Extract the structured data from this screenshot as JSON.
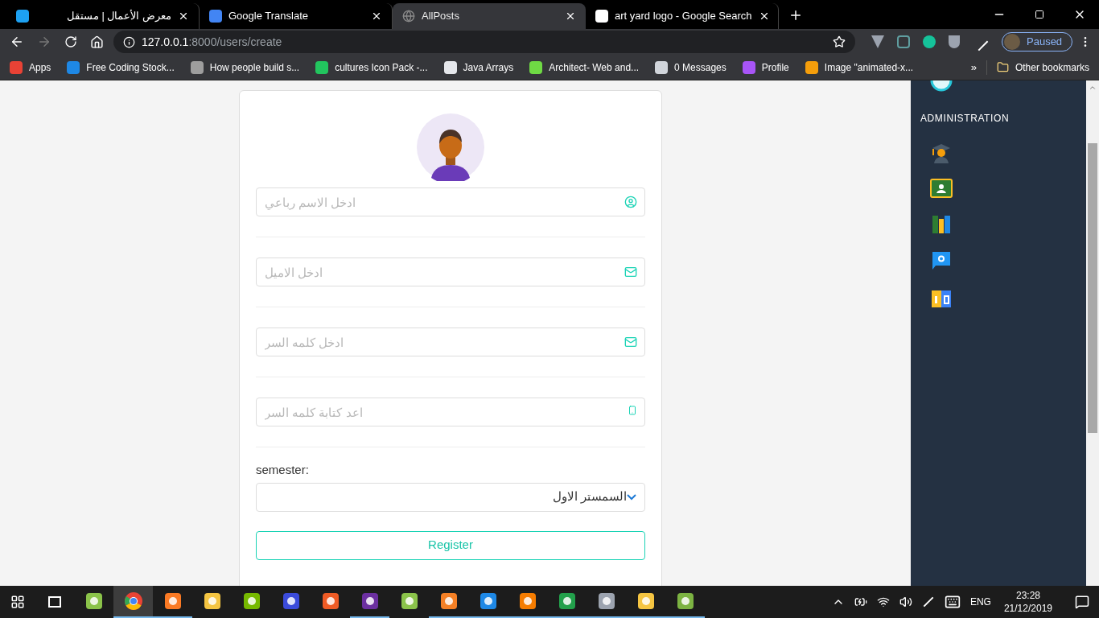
{
  "browser": {
    "tabs": [
      {
        "title": "معرض الأعمال | مستقل",
        "selected": false
      },
      {
        "title": "Google Translate",
        "selected": false
      },
      {
        "title": "AllPosts",
        "selected": true
      },
      {
        "title": "art yard logo - Google Search",
        "selected": false
      }
    ],
    "address": {
      "host": "127.0.0.1",
      "rest": ":8000/users/create"
    },
    "profile": {
      "label": "Paused"
    },
    "bookmarks": [
      {
        "title": "Apps"
      },
      {
        "title": "Free Coding Stock..."
      },
      {
        "title": "How people build s..."
      },
      {
        "title": "cultures Icon Pack -..."
      },
      {
        "title": "Java Arrays"
      },
      {
        "title": "Architect- Web and..."
      },
      {
        "title": "0 Messages"
      },
      {
        "title": "Profile"
      },
      {
        "title": "Image \"animated-x..."
      }
    ],
    "overflow": "»",
    "other_bookmarks": "Other bookmarks"
  },
  "form": {
    "fields": [
      {
        "placeholder": "ادخل الاسم رباعي"
      },
      {
        "placeholder": "ادخل الاميل"
      },
      {
        "placeholder": "ادخل كلمه السر"
      },
      {
        "placeholder": "اعد كتابة كلمه السر"
      }
    ],
    "select": {
      "label": "semester:",
      "value": "السمستر الاول"
    },
    "button": "Register"
  },
  "sidebar": {
    "heading": "ADMINISTRATION"
  },
  "taskbar": {
    "apps": [
      {
        "selected": false,
        "running": false
      },
      {
        "selected": true,
        "running": true
      },
      {
        "selected": false,
        "running": true
      },
      {
        "selected": false,
        "running": false
      },
      {
        "selected": false,
        "running": false
      },
      {
        "selected": false,
        "running": false
      },
      {
        "selected": false,
        "running": false
      },
      {
        "selected": false,
        "running": true
      },
      {
        "selected": false,
        "running": false
      },
      {
        "selected": false,
        "running": true
      },
      {
        "selected": false,
        "running": true
      },
      {
        "selected": false,
        "running": true
      },
      {
        "selected": false,
        "running": true
      },
      {
        "selected": false,
        "running": true
      },
      {
        "selected": false,
        "running": true
      },
      {
        "selected": false,
        "running": true
      }
    ],
    "language": "ENG",
    "time": "23:28",
    "date": "21/12/2019"
  }
}
